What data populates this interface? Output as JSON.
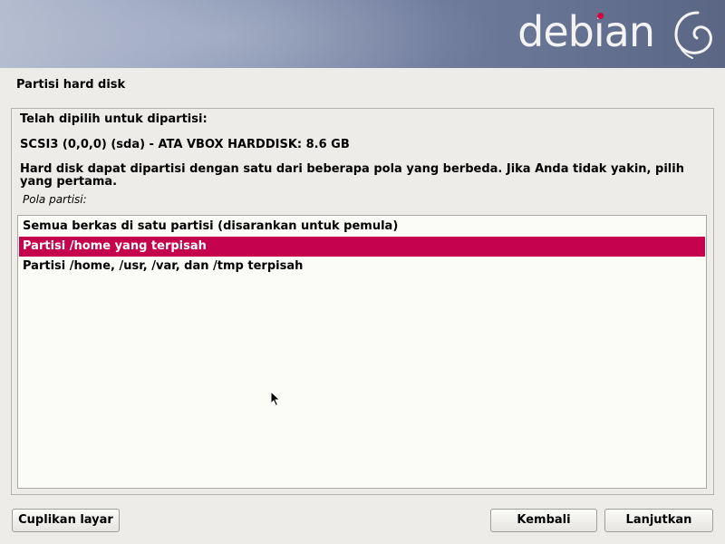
{
  "header": {
    "brand": "debian",
    "accent_color": "#d0003c"
  },
  "page_title": "Partisi hard disk",
  "panel": {
    "selected_label": "Telah dipilih untuk dipartisi:",
    "disk": "SCSI3 (0,0,0) (sda) - ATA VBOX HARDDISK: 8.6 GB",
    "description": "Hard disk dapat dipartisi dengan satu dari beberapa pola yang berbeda. Jika Anda tidak yakin, pilih yang pertama.",
    "list_label": "Pola partisi:"
  },
  "options": [
    {
      "label": "Semua berkas di satu partisi (disarankan untuk pemula)",
      "selected": false
    },
    {
      "label": "Partisi /home yang terpisah",
      "selected": true
    },
    {
      "label": "Partisi /home, /usr, /var, dan /tmp terpisah",
      "selected": false
    }
  ],
  "buttons": {
    "screenshot": "Cuplikan layar",
    "back": "Kembali",
    "continue": "Lanjutkan"
  },
  "colors": {
    "selection": "#c5024c",
    "background": "#edece8"
  }
}
